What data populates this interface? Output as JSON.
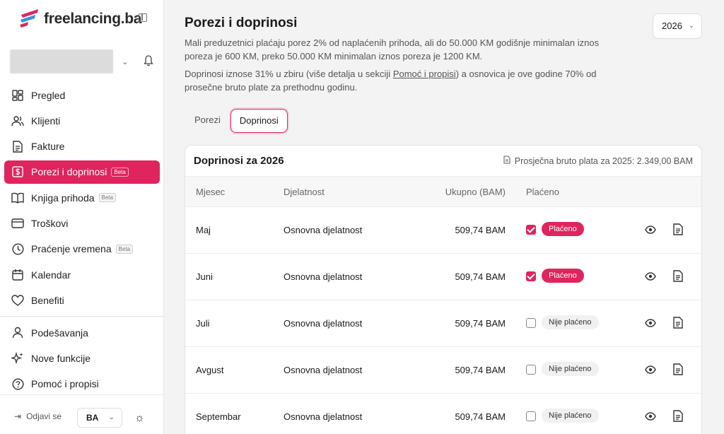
{
  "app": {
    "brand": "freelancing.ba"
  },
  "sidebar": {
    "items": [
      {
        "label": "Pregled",
        "icon": "dashboard-grid-icon",
        "beta": ""
      },
      {
        "label": "Klijenti",
        "icon": "users-icon",
        "beta": ""
      },
      {
        "label": "Fakture",
        "icon": "document-icon",
        "beta": ""
      },
      {
        "label": "Porezi i doprinosi",
        "icon": "dollar-square-icon",
        "beta": "Beta",
        "active": true
      },
      {
        "label": "Knjiga prihoda",
        "icon": "book-open-icon",
        "beta": "Beta"
      },
      {
        "label": "Troškovi",
        "icon": "credit-card-icon",
        "beta": ""
      },
      {
        "label": "Praćenje vremena",
        "icon": "clock-icon",
        "beta": "Beta"
      },
      {
        "label": "Kalendar",
        "icon": "calendar-icon",
        "beta": ""
      },
      {
        "label": "Benefiti",
        "icon": "heart-icon",
        "beta": ""
      }
    ],
    "secondary": [
      {
        "label": "Podešavanja",
        "icon": "user-settings-icon"
      },
      {
        "label": "Nove funkcije",
        "icon": "sparkles-icon"
      },
      {
        "label": "Pomoć i propisi",
        "icon": "help-circle-icon"
      }
    ],
    "footer": {
      "logout": "Odjavi se",
      "lang": "BA"
    }
  },
  "header": {
    "title": "Porezi i doprinosi",
    "year": "2026",
    "desc1": "Mali preduzetnici plaćaju porez 2% od naplaćenih prihoda, ali do 50.000 KM godišnje minimalan iznos poreza je 600 KM, preko 50.000 KM minimalan iznos poreza je 1200 KM.",
    "desc2_pre": "Doprinosi iznose 31% u zbiru (više detalja u sekciji ",
    "desc2_link": "Pomoć i propisi",
    "desc2_post": ") a osnovica je ove godine 70% od prosečne bruto plate za prethodnu godinu."
  },
  "tabs": [
    {
      "label": "Porezi",
      "active": false
    },
    {
      "label": "Doprinosi",
      "active": true
    }
  ],
  "card": {
    "title": "Doprinosi za 2026",
    "meta": "Prosječna bruto plata za 2025: 2.349,00 BAM",
    "columns": {
      "month": "Mjesec",
      "activity": "Djelatnost",
      "total": "Ukupno (BAM)",
      "paid": "Plaćeno"
    },
    "rows": [
      {
        "month": "Maj",
        "activity": "Osnovna djelatnost",
        "total": "509,74 BAM",
        "paid": true,
        "status": "Plaćeno"
      },
      {
        "month": "Juni",
        "activity": "Osnovna djelatnost",
        "total": "509,74 BAM",
        "paid": true,
        "status": "Plaćeno"
      },
      {
        "month": "Juli",
        "activity": "Osnovna djelatnost",
        "total": "509,74 BAM",
        "paid": false,
        "status": "Nije plaćeno"
      },
      {
        "month": "Avgust",
        "activity": "Osnovna djelatnost",
        "total": "509,74 BAM",
        "paid": false,
        "status": "Nije plaćeno"
      },
      {
        "month": "Septembar",
        "activity": "Osnovna djelatnost",
        "total": "509,74 BAM",
        "paid": false,
        "status": "Nije plaćeno"
      }
    ]
  },
  "colors": {
    "accent": "#e0245e"
  }
}
